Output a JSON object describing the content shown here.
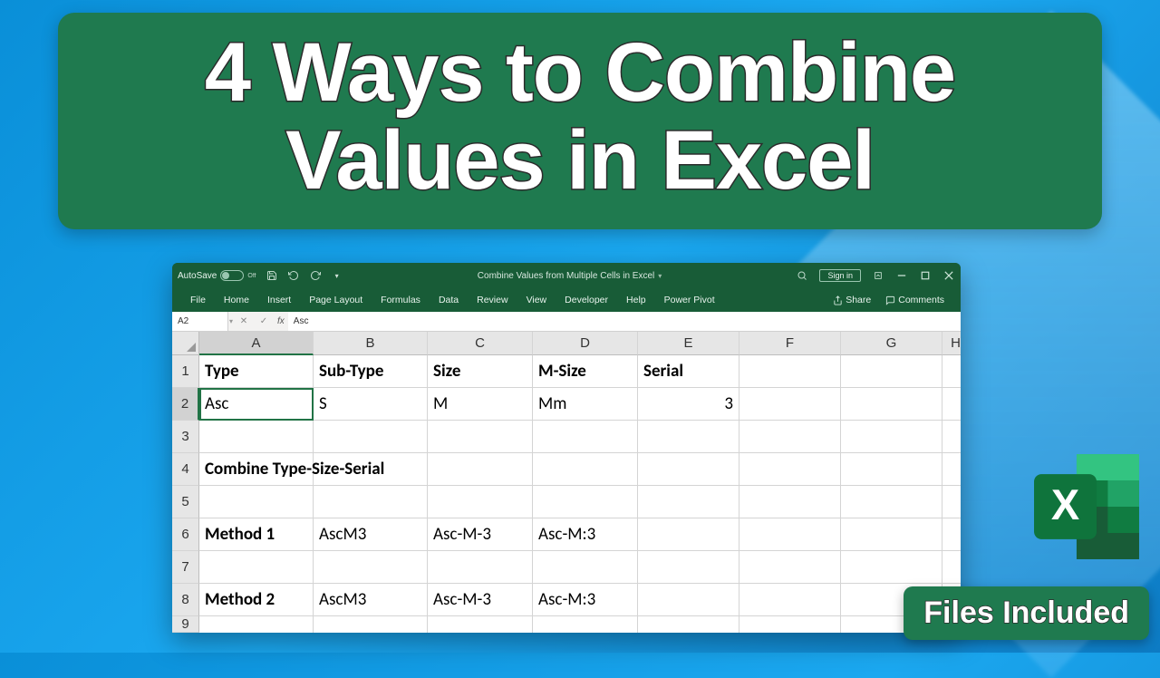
{
  "banner": {
    "line1": "4 Ways to Combine",
    "line2": "Values in Excel"
  },
  "titlebar": {
    "autosave_label": "AutoSave",
    "autosave_state": "Off",
    "doc_title": "Combine Values from Multiple Cells in Excel",
    "signin": "Sign in"
  },
  "ribbon": {
    "tabs": [
      "File",
      "Home",
      "Insert",
      "Page Layout",
      "Formulas",
      "Data",
      "Review",
      "View",
      "Developer",
      "Help",
      "Power Pivot"
    ],
    "share": "Share",
    "comments": "Comments"
  },
  "formula_bar": {
    "name_box": "A2",
    "formula": "Asc"
  },
  "sheet": {
    "columns": [
      "A",
      "B",
      "C",
      "D",
      "E",
      "F",
      "G",
      "H"
    ],
    "row_numbers": [
      "1",
      "2",
      "3",
      "4",
      "5",
      "6",
      "7",
      "8",
      "9"
    ],
    "active_cell": "A2",
    "rows": [
      [
        {
          "v": "Type",
          "bold": true
        },
        {
          "v": "Sub-Type",
          "bold": true
        },
        {
          "v": "Size",
          "bold": true
        },
        {
          "v": "M-Size",
          "bold": true
        },
        {
          "v": "Serial",
          "bold": true
        },
        {
          "v": ""
        },
        {
          "v": ""
        },
        {
          "v": ""
        }
      ],
      [
        {
          "v": "Asc",
          "active": true
        },
        {
          "v": "S"
        },
        {
          "v": "M"
        },
        {
          "v": "Mm"
        },
        {
          "v": "3",
          "right": true
        },
        {
          "v": ""
        },
        {
          "v": ""
        },
        {
          "v": ""
        }
      ],
      [
        {
          "v": ""
        },
        {
          "v": ""
        },
        {
          "v": ""
        },
        {
          "v": ""
        },
        {
          "v": ""
        },
        {
          "v": ""
        },
        {
          "v": ""
        },
        {
          "v": ""
        }
      ],
      [
        {
          "v": "Combine Type-Size-Serial",
          "bold": true
        },
        {
          "v": ""
        },
        {
          "v": ""
        },
        {
          "v": ""
        },
        {
          "v": ""
        },
        {
          "v": ""
        },
        {
          "v": ""
        },
        {
          "v": ""
        }
      ],
      [
        {
          "v": ""
        },
        {
          "v": ""
        },
        {
          "v": ""
        },
        {
          "v": ""
        },
        {
          "v": ""
        },
        {
          "v": ""
        },
        {
          "v": ""
        },
        {
          "v": ""
        }
      ],
      [
        {
          "v": "Method 1",
          "bold": true
        },
        {
          "v": "AscM3"
        },
        {
          "v": "Asc-M-3"
        },
        {
          "v": "Asc-M:3"
        },
        {
          "v": ""
        },
        {
          "v": ""
        },
        {
          "v": ""
        },
        {
          "v": ""
        }
      ],
      [
        {
          "v": ""
        },
        {
          "v": ""
        },
        {
          "v": ""
        },
        {
          "v": ""
        },
        {
          "v": ""
        },
        {
          "v": ""
        },
        {
          "v": ""
        },
        {
          "v": ""
        }
      ],
      [
        {
          "v": "Method 2",
          "bold": true
        },
        {
          "v": "AscM3"
        },
        {
          "v": "Asc-M-3"
        },
        {
          "v": "Asc-M:3"
        },
        {
          "v": ""
        },
        {
          "v": ""
        },
        {
          "v": ""
        },
        {
          "v": ""
        }
      ],
      [
        {
          "v": ""
        },
        {
          "v": ""
        },
        {
          "v": ""
        },
        {
          "v": ""
        },
        {
          "v": ""
        },
        {
          "v": ""
        },
        {
          "v": ""
        },
        {
          "v": ""
        }
      ]
    ]
  },
  "badge": "Files Included"
}
